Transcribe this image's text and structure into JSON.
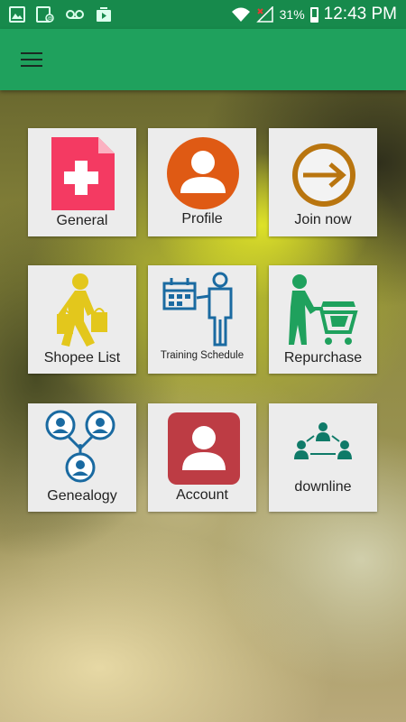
{
  "status_bar": {
    "battery": "31%",
    "time": "12:43 PM",
    "icons": [
      "image-icon",
      "voicemail-alt-icon",
      "voicemail-icon",
      "media-icon",
      "wifi-icon",
      "signal-icon",
      "battery-icon"
    ]
  },
  "app_bar": {
    "menu_icon": "hamburger-icon"
  },
  "tiles": [
    {
      "label": "General",
      "icon": "medical-document-icon"
    },
    {
      "label": "Profile",
      "icon": "user-circle-icon"
    },
    {
      "label": "Join now",
      "icon": "enter-arrow-icon"
    },
    {
      "label": "Shopee List",
      "icon": "shopper-icon"
    },
    {
      "label": "Training Schedule",
      "icon": "schedule-presenter-icon"
    },
    {
      "label": "Repurchase",
      "icon": "shopping-cart-person-icon"
    },
    {
      "label": "Genealogy",
      "icon": "family-tree-icon"
    },
    {
      "label": "Account",
      "icon": "account-card-icon"
    },
    {
      "label": "downline",
      "icon": "network-people-icon"
    }
  ],
  "colors": {
    "status_bar": "#178a4c",
    "app_bar": "#1fa15d",
    "general_icon": "#f43a62",
    "profile_icon": "#df5a14",
    "join_icon": "#b9750f",
    "shopee_icon": "#e3c71c",
    "training_icon": "#1a6aa1",
    "repurchase_icon": "#1fa15d",
    "genealogy_icon": "#1a6aa1",
    "account_icon": "#bd3c44",
    "downline_icon": "#0f7a68"
  }
}
